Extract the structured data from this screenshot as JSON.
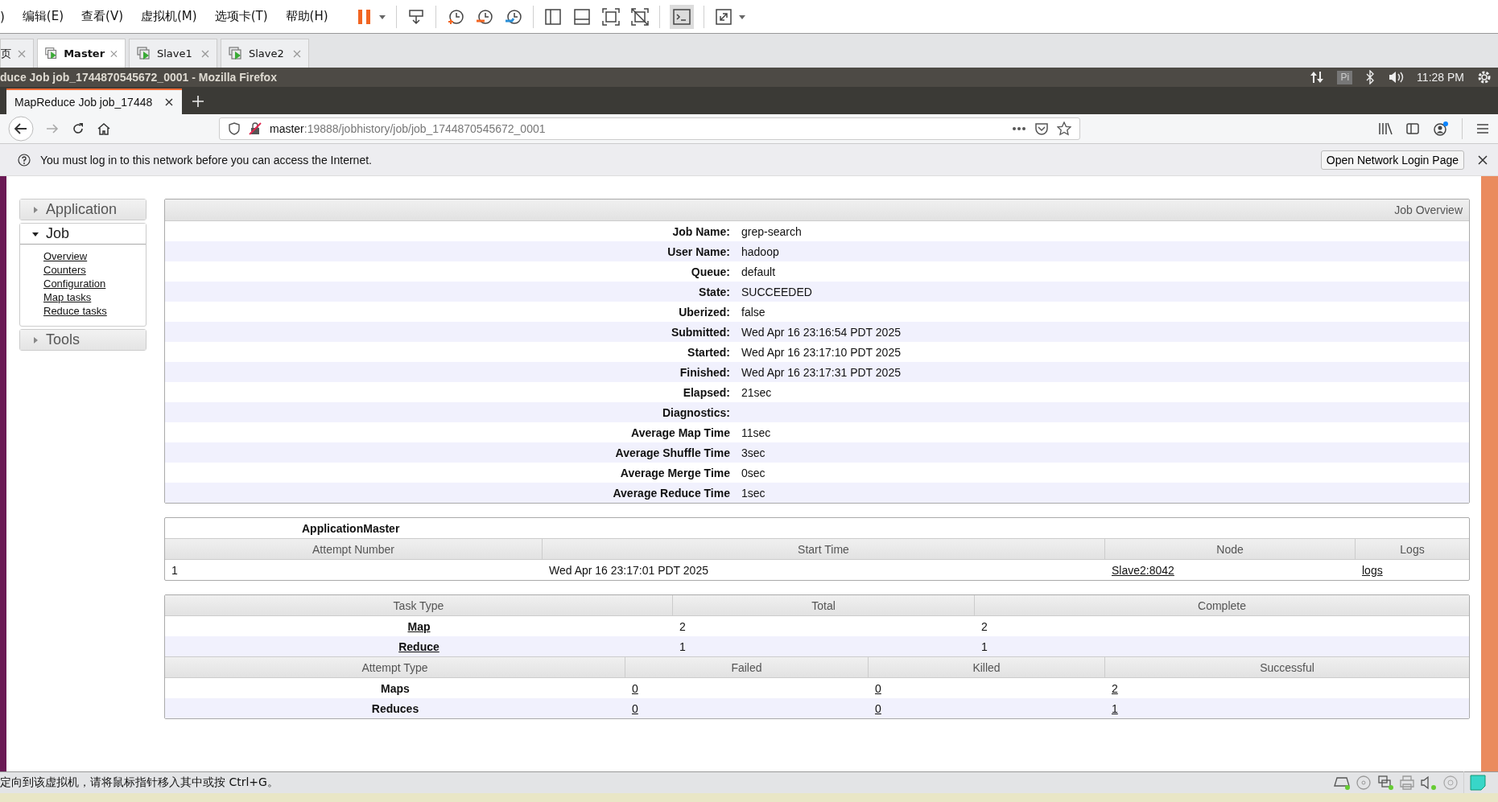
{
  "vm_menu": [
    ")",
    "编辑(E)",
    "查看(V)",
    "虚拟机(M)",
    "选项卡(T)",
    "帮助(H)"
  ],
  "vm_tabs": [
    {
      "label": "页",
      "selected": false
    },
    {
      "label": "Master",
      "selected": true
    },
    {
      "label": "Slave1",
      "selected": false
    },
    {
      "label": "Slave2",
      "selected": false
    }
  ],
  "desktop_bar": {
    "window_title": "duce Job job_1744870545672_0001 - Mozilla Firefox",
    "keyboard": "Pi",
    "time": "11:28 PM"
  },
  "browser": {
    "tab_title": "MapReduce Job job_17448",
    "url_host": "master",
    "url_path": ":19888/jobhistory/job/job_1744870545672_0001",
    "notification": {
      "message": "You must log in to this network before you can access the Internet.",
      "button": "Open Network Login Page"
    }
  },
  "sidebar": [
    {
      "label": "Application",
      "expanded": false
    },
    {
      "label": "Job",
      "expanded": true,
      "children": [
        "Overview",
        "Counters",
        "Configuration",
        "Map tasks",
        "Reduce tasks"
      ]
    },
    {
      "label": "Tools",
      "expanded": false
    }
  ],
  "job_overview": {
    "title": "Job Overview",
    "rows": [
      {
        "label": "Job Name:",
        "value": "grep-search"
      },
      {
        "label": "User Name:",
        "value": "hadoop"
      },
      {
        "label": "Queue:",
        "value": "default"
      },
      {
        "label": "State:",
        "value": "SUCCEEDED"
      },
      {
        "label": "Uberized:",
        "value": "false"
      },
      {
        "label": "Submitted:",
        "value": "Wed Apr 16 23:16:54 PDT 2025"
      },
      {
        "label": "Started:",
        "value": "Wed Apr 16 23:17:10 PDT 2025"
      },
      {
        "label": "Finished:",
        "value": "Wed Apr 16 23:17:31 PDT 2025"
      },
      {
        "label": "Elapsed:",
        "value": "21sec"
      },
      {
        "label": "Diagnostics:"
      },
      {
        "label": "Average Map Time",
        "value": "11sec"
      },
      {
        "label": "Average Shuffle Time",
        "value": "3sec"
      },
      {
        "label": "Average Merge Time",
        "value": "0sec"
      },
      {
        "label": "Average Reduce Time",
        "value": "1sec"
      }
    ]
  },
  "application_master": {
    "title": "ApplicationMaster",
    "columns": [
      "Attempt Number",
      "Start Time",
      "Node",
      "Logs"
    ],
    "rows": [
      [
        {
          "text": "1",
          "link": false
        },
        {
          "text": "Wed Apr 16 23:17:01 PDT 2025",
          "link": false
        },
        {
          "text": "Slave2:8042",
          "link": true
        },
        {
          "text": "logs",
          "link": true
        }
      ]
    ]
  },
  "tasks": {
    "columns": [
      "Task Type",
      "Total",
      "Complete"
    ],
    "rows": [
      [
        {
          "text": "Map",
          "link": true
        },
        {
          "text": "2",
          "link": false
        },
        {
          "text": "2",
          "link": false
        }
      ],
      [
        {
          "text": "Reduce",
          "link": true
        },
        {
          "text": "1",
          "link": false
        },
        {
          "text": "1",
          "link": false
        }
      ]
    ]
  },
  "attempts": {
    "columns": [
      "Attempt Type",
      "Failed",
      "Killed",
      "Successful"
    ],
    "rows": [
      [
        {
          "text": "Maps",
          "link": false
        },
        {
          "text": "0",
          "link": true
        },
        {
          "text": "0",
          "link": true
        },
        {
          "text": "2",
          "link": true
        }
      ],
      [
        {
          "text": "Reduces",
          "link": false
        },
        {
          "text": "0",
          "link": true
        },
        {
          "text": "0",
          "link": true
        },
        {
          "text": "1",
          "link": true
        }
      ]
    ]
  },
  "status_bar": {
    "message": "定向到该虚拟机，请将鼠标指针移入其中或按 Ctrl+G。"
  }
}
